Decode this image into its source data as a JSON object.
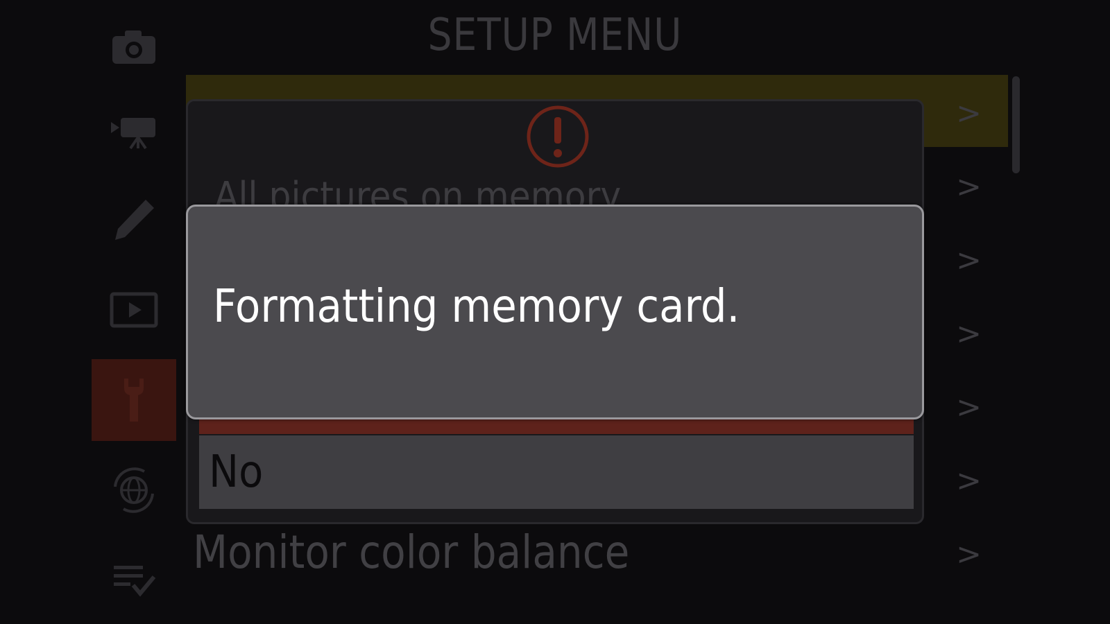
{
  "header": {
    "title": "SETUP MENU"
  },
  "sidebar": {
    "tabs": [
      {
        "icon": "camera-icon",
        "active": false
      },
      {
        "icon": "movie-camera-icon",
        "active": false
      },
      {
        "icon": "pencil-icon",
        "active": false
      },
      {
        "icon": "playback-icon",
        "active": false
      },
      {
        "icon": "wrench-icon",
        "active": true
      },
      {
        "icon": "globe-network-icon",
        "active": false
      },
      {
        "icon": "my-menu-icon",
        "active": false
      }
    ]
  },
  "menu": {
    "items": [
      {
        "label": "",
        "chevron": ">"
      },
      {
        "label": "",
        "chevron": ">"
      },
      {
        "label": "",
        "chevron": ">"
      },
      {
        "label": "",
        "chevron": ">"
      },
      {
        "label": "",
        "chevron": ">"
      },
      {
        "label": "",
        "chevron": ">"
      },
      {
        "label": "Monitor color balance",
        "chevron": ">"
      }
    ]
  },
  "confirm_dialog": {
    "icon": "warning-icon",
    "message": "All pictures on memory",
    "options": {
      "no": "No"
    }
  },
  "progress_dialog": {
    "message": "Formatting memory card."
  },
  "colors": {
    "accent_highlight": "#2f2a0c",
    "selected_tab": "#3a1510",
    "warning_red": "#c0392b",
    "yes_option": "#5e221b"
  }
}
